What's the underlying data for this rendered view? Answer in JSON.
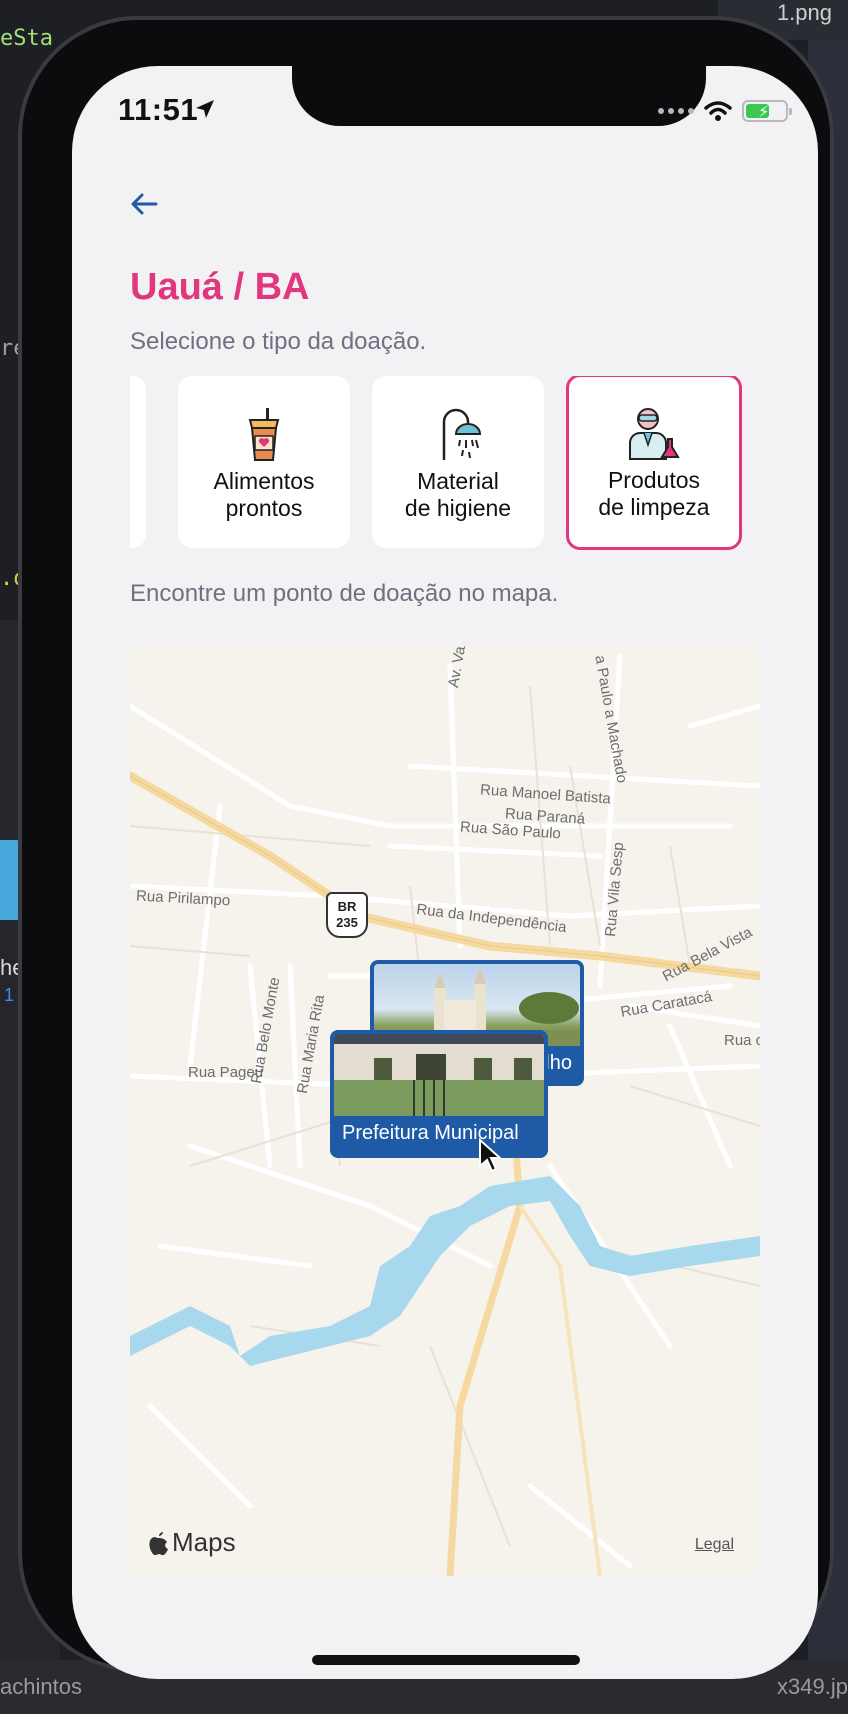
{
  "desktop": {
    "code_top": "eSta",
    "code_mid": "re",
    "code_low": ".o",
    "top_right_file": "1.png",
    "left_text": "he",
    "left_num": "1",
    "bottom_left": "achintos",
    "bottom_right": "x349.jp"
  },
  "status": {
    "time": "11:51",
    "location_icon": "location-arrow-icon",
    "wifi_icon": "wifi-icon",
    "battery_icon": "battery-charging-icon"
  },
  "header": {
    "back_icon": "arrow-left-icon",
    "title": "Uauá / BA",
    "subtitle": "Selecione o tipo da doação."
  },
  "donation_types": [
    {
      "label": "Alimentos\nprontos",
      "icon": "coffee-cup-icon",
      "selected": false
    },
    {
      "label": "Material\nde higiene",
      "icon": "shower-icon",
      "selected": false
    },
    {
      "label": "Produtos\nde limpeza",
      "icon": "scientist-icon",
      "selected": true
    }
  ],
  "map_section": {
    "hint": "Encontre um ponto de doação no mapa.",
    "streets": [
      "Av. Vaza Barris",
      "a Paulo a Machado",
      "Rua Manoel Batista",
      "Rua Paraná",
      "Rua São Paulo",
      "Rua Vila Sesp",
      "Rua Pirilampo",
      "Rua da Independência",
      "Rua Bela Vista",
      "Rua Caratacá",
      "Rua c",
      "Rua Belo Monte",
      "Rua Maria Rita",
      "Rua Pageu",
      "ulho"
    ],
    "highway_shield": {
      "line1": "BR",
      "line2": "235"
    },
    "pins": [
      {
        "label": "Prefeitura Municipal"
      }
    ],
    "maps_logo": "Maps",
    "legal": "Legal",
    "colors": {
      "water": "#a8d8ee",
      "major_road": "#f6d9a0",
      "pin": "#1e5aa6"
    }
  },
  "accent_color": "#e0377f"
}
